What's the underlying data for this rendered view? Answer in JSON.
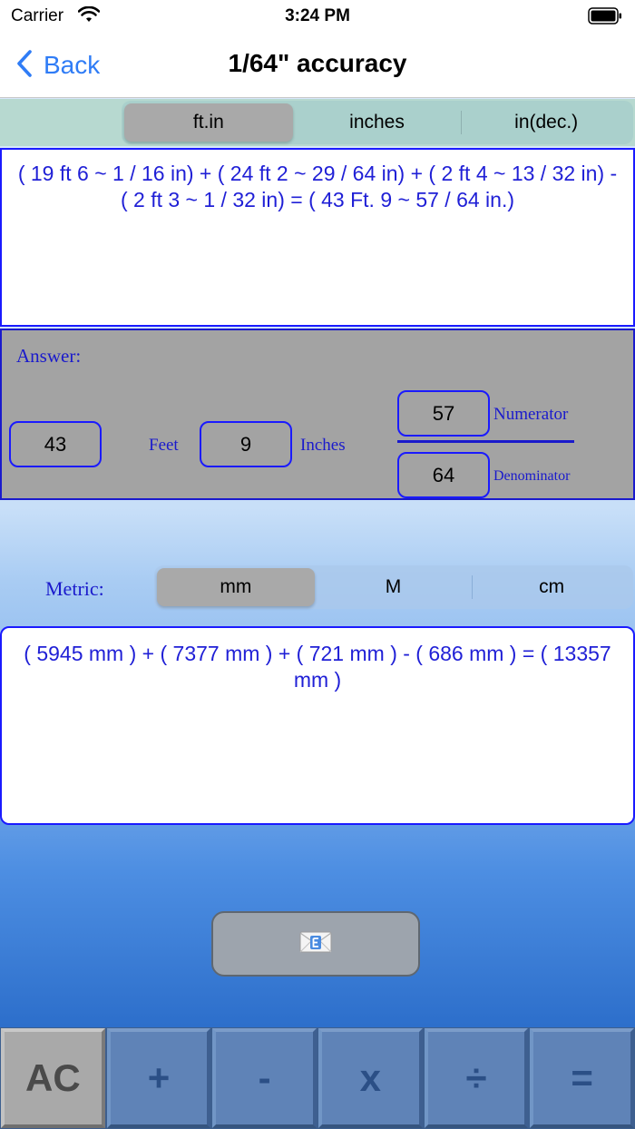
{
  "status": {
    "carrier": "Carrier",
    "time": "3:24 PM"
  },
  "nav": {
    "back_label": "Back",
    "title": "1/64\" accuracy"
  },
  "imperial_segment": {
    "items": [
      "ft.in",
      "inches",
      "in(dec.)"
    ],
    "selected": "ft.in"
  },
  "imperial_formula": "( 19 ft 6 ~ 1 / 16 in)  +  ( 24 ft 2 ~ 29 / 64 in)  +  ( 2 ft 4 ~ 13 / 32 in)  -  ( 2 ft 3 ~ 1 / 32 in)  = ( 43 Ft. 9 ~ 57 / 64 in.)",
  "answer": {
    "label": "Answer:",
    "feet_value": "43",
    "feet_label": "Feet",
    "inches_value": "9",
    "inches_label": "Inches",
    "numerator_value": "57",
    "numerator_label": "Numerator",
    "denominator_value": "64",
    "denominator_label": "Denominator"
  },
  "metric": {
    "label": "Metric:",
    "segment": [
      "mm",
      "M",
      "cm"
    ],
    "selected": "mm",
    "formula": "( 5945 mm )  +  ( 7377 mm )  +  ( 721 mm )  -  ( 686 mm )  = ( 13357 mm )"
  },
  "email_button": {
    "icon": "envelope-e-icon"
  },
  "keypad": [
    "AC",
    "+",
    "-",
    "x",
    "÷",
    "="
  ],
  "colors": {
    "accent_blue": "#1a1aff",
    "ios_blue": "#2f7cf6",
    "panel_gray": "#a3a3a3"
  }
}
